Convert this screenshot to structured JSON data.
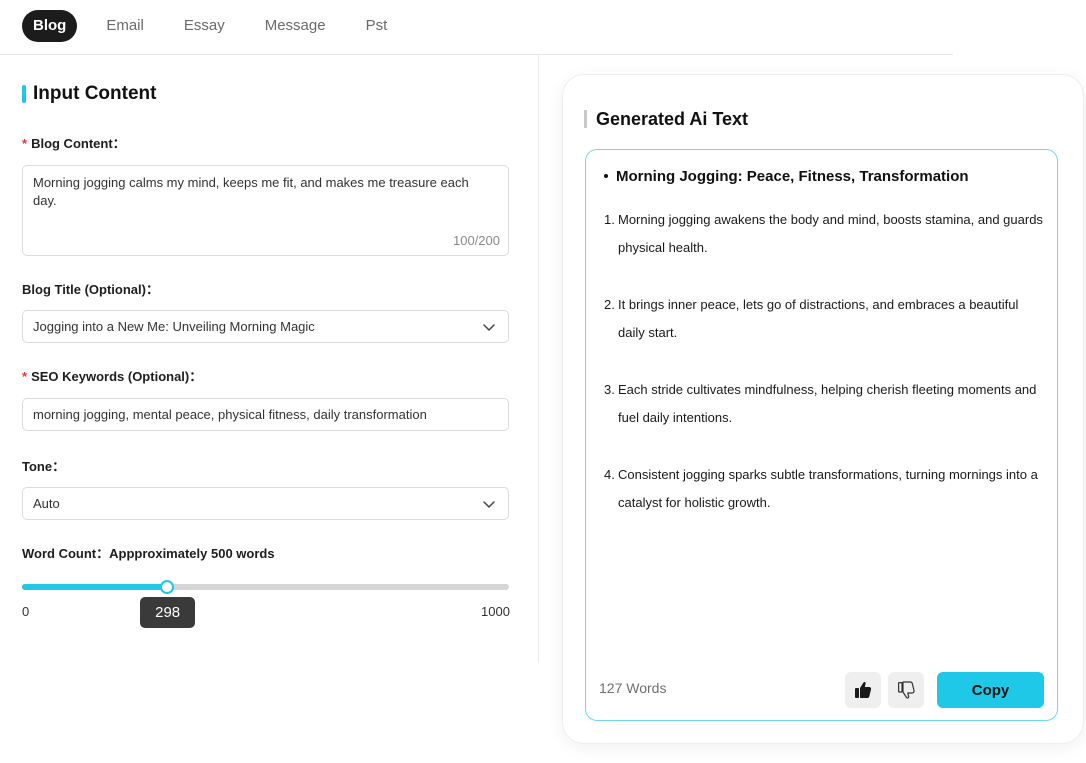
{
  "tabs": [
    "Blog",
    "Email",
    "Essay",
    "Message",
    "Pst"
  ],
  "input": {
    "section_title": "Input Content",
    "blog_content_label": "Blog Content：",
    "blog_content_value": "Morning jogging calms my mind, keeps me fit, and makes me treasure each day.",
    "blog_content_counter": "100/200",
    "title_label": "Blog Title (Optional)：",
    "title_value": "Jogging into a New Me: Unveiling Morning Magic",
    "seo_label": "SEO Keywords (Optional)：",
    "seo_value": "morning jogging, mental peace, physical fitness, daily transformation",
    "tone_label": "Tone：",
    "tone_value": "Auto",
    "word_count_label": "Word Count：Appproximately 500 words",
    "slider_min": "0",
    "slider_max": "1000",
    "slider_value": "298"
  },
  "output": {
    "title": "Generated Ai Text",
    "heading": "Morning Jogging: Peace, Fitness, Transformation",
    "items": [
      {
        "num": "1.",
        "text": "Morning jogging awakens the body and mind, boosts stamina, and guards physical health."
      },
      {
        "num": "2.",
        "text": "It brings inner peace, lets go of distractions, and embraces a beautiful daily start."
      },
      {
        "num": "3.",
        "text": "Each stride cultivates mindfulness, helping cherish fleeting moments and fuel daily intentions."
      },
      {
        "num": "4.",
        "text": "Consistent jogging sparks subtle transformations, turning mornings into a catalyst for holistic growth."
      }
    ],
    "word_count": "127 Words",
    "copy_label": "Copy"
  },
  "icons": {
    "like": "thumbs-up-icon",
    "dislike": "thumbs-down-icon",
    "dropdown": "chevron-down-icon"
  },
  "colors": {
    "accent": "#1ec8e6",
    "active_tab": "#1c1c1c",
    "required": "#e03a3a"
  }
}
